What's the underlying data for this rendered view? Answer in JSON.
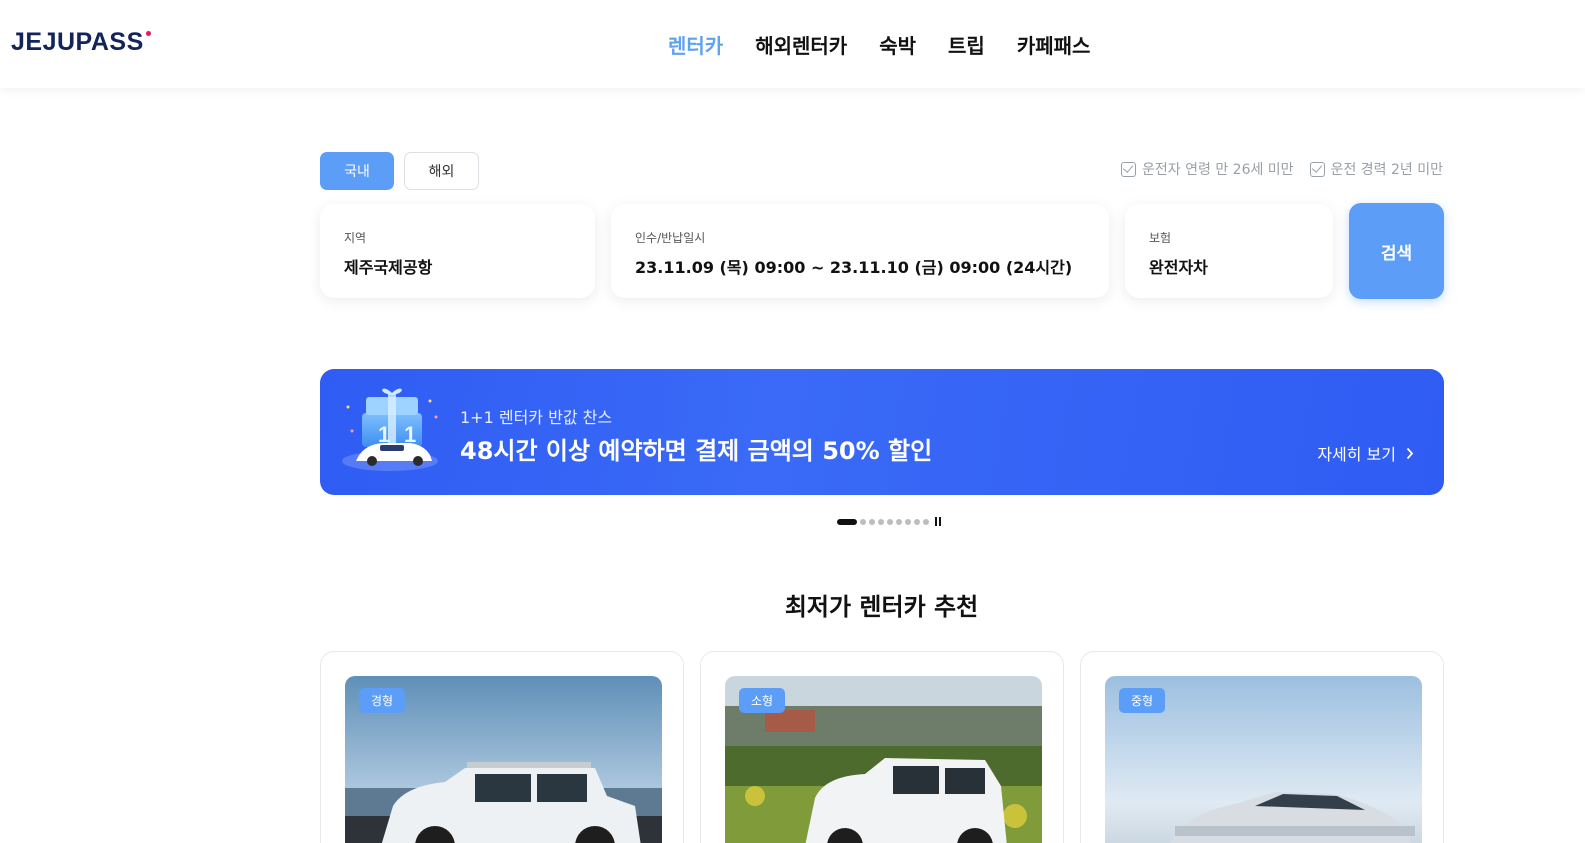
{
  "header": {
    "logo": "JEJUPASS",
    "nav": [
      "렌터카",
      "해외렌터카",
      "숙박",
      "트립",
      "카페패스"
    ],
    "active_index": 0
  },
  "tabs": {
    "domestic": "국내",
    "overseas": "해외"
  },
  "filters": {
    "age": "운전자 연령 만 26세 미만",
    "experience": "운전 경력 2년 미만"
  },
  "search": {
    "region_label": "지역",
    "region_value": "제주국제공항",
    "date_label": "인수/반납일시",
    "date_value": "23.11.09 (목) 09:00 ~ 23.11.10 (금) 09:00 (24시간)",
    "insurance_label": "보험",
    "insurance_value": "완전자차",
    "button": "검색"
  },
  "banner": {
    "subtitle": "1+1 렌터카 반값 찬스",
    "title": "48시간 이상 예약하면 결제 금액의 50% 할인",
    "more": "자세히 보기"
  },
  "pagination": {
    "total": 9,
    "current": 1
  },
  "section_title": "최저가 렌터카 추천",
  "cars": [
    {
      "tag": "경형"
    },
    {
      "tag": "소형"
    },
    {
      "tag": "중형"
    }
  ],
  "colors": {
    "accent": "#5b9df7",
    "banner": "#2f5cf3",
    "brand": "#13245a"
  }
}
